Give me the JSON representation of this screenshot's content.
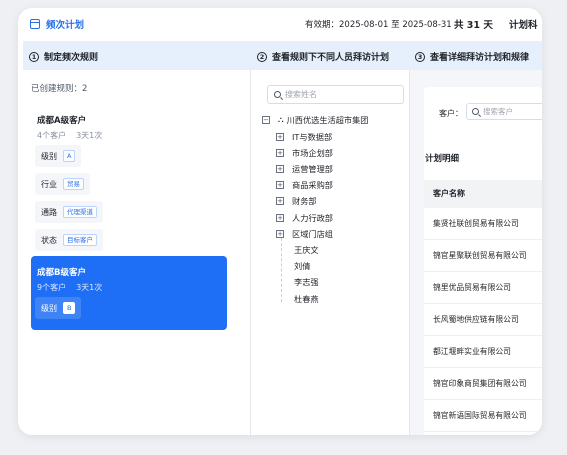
{
  "header": {
    "title": "频次计划",
    "validity_label": "有效期：",
    "validity_range": "2025-08-01 至 2025-08-31",
    "total_days": "共 31 天",
    "plan_label": "计划科"
  },
  "steps": [
    {
      "num": "1",
      "label": "制定频次规则"
    },
    {
      "num": "2",
      "label": "查看规则下不同人员拜访计划"
    },
    {
      "num": "3",
      "label": "查看详细拜访计划和规律"
    }
  ],
  "rules": {
    "created_text": "已创建规则：2",
    "items": [
      {
        "name": "成都A级客户",
        "customers": "4个客户",
        "frequency": "3天1次",
        "conditions": [
          {
            "label": "级别",
            "tag": "A"
          },
          {
            "label": "行业",
            "tag": "贸易"
          },
          {
            "label": "通路",
            "tag": "代理渠道"
          },
          {
            "label": "状态",
            "tag": "目标客户"
          }
        ]
      },
      {
        "name": "成都B级客户",
        "customers": "9个客户",
        "frequency": "3天1次",
        "conditions": [
          {
            "label": "级别",
            "tag": "B"
          }
        ]
      }
    ]
  },
  "org_tree": {
    "search_placeholder": "搜索姓名",
    "root": "川西优选生活超市集团",
    "departments": [
      "IT与数据部",
      "市场企划部",
      "运营管理部",
      "商品采购部",
      "财务部",
      "人力行政部",
      "区域门店组"
    ],
    "people": [
      "王庆文",
      "刘倩",
      "李志强",
      "杜春燕"
    ]
  },
  "plan_detail": {
    "customer_filter_label": "客户：",
    "customer_search_placeholder": "搜索客户",
    "section_title": "计划明细",
    "column_header": "客户名称",
    "rows": [
      "集贤社联创贸易有限公司",
      "锦官星聚联创贸易有限公司",
      "锦里优品贸易有限公司",
      "长风蜀地供应链有限公司",
      "都江堰畔实业有限公司",
      "锦官印象商贸集团有限公司",
      "锦官新语国际贸易有限公司"
    ]
  },
  "colors": {
    "accent": "#1e6ff5",
    "step_bar": "#e6f0fc"
  }
}
